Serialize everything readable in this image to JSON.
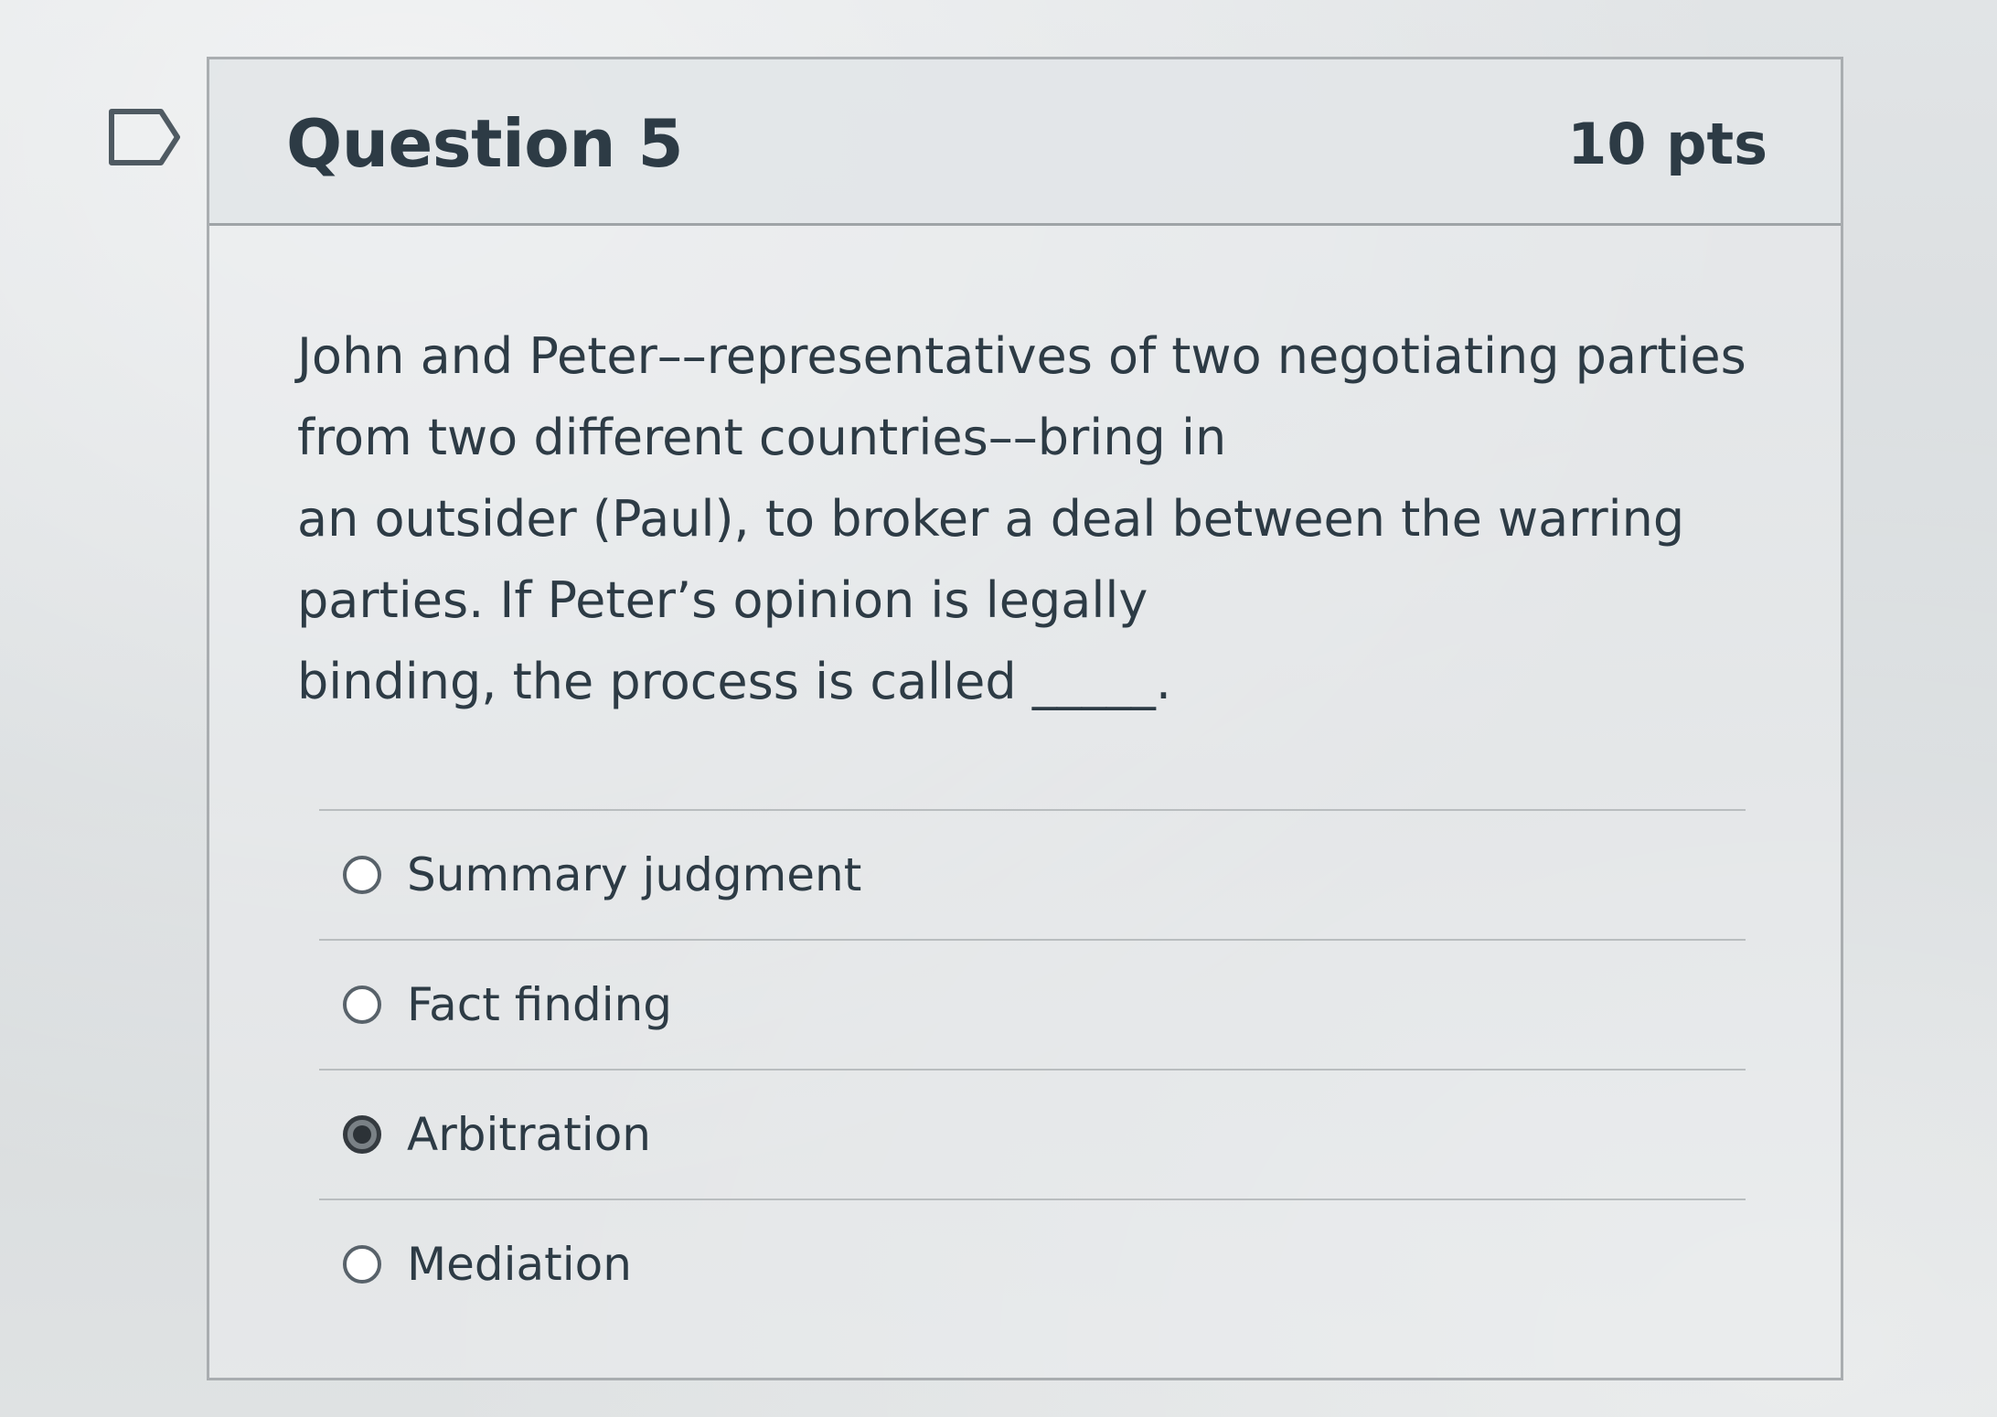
{
  "question": {
    "title": "Question 5",
    "points": "10 pts",
    "text_lines": [
      "John and Peter––representatives of two negotiating parties",
      "from two different countries––bring in",
      "an outsider (Paul), to broker a deal between the warring",
      "parties. If Peter’s opinion is legally",
      "binding, the process is called _____."
    ]
  },
  "answers": [
    {
      "label": "Summary judgment",
      "selected": false
    },
    {
      "label": "Fact finding",
      "selected": false
    },
    {
      "label": "Arbitration",
      "selected": true
    },
    {
      "label": "Mediation",
      "selected": false
    }
  ],
  "icons": {
    "flag": "flag-question-icon",
    "radio_unselected": "radio-empty-icon",
    "radio_selected": "radio-filled-icon"
  },
  "colors": {
    "text": "#2d3b45",
    "border": "#a9adb0",
    "radio_selected": "#2c3237"
  }
}
